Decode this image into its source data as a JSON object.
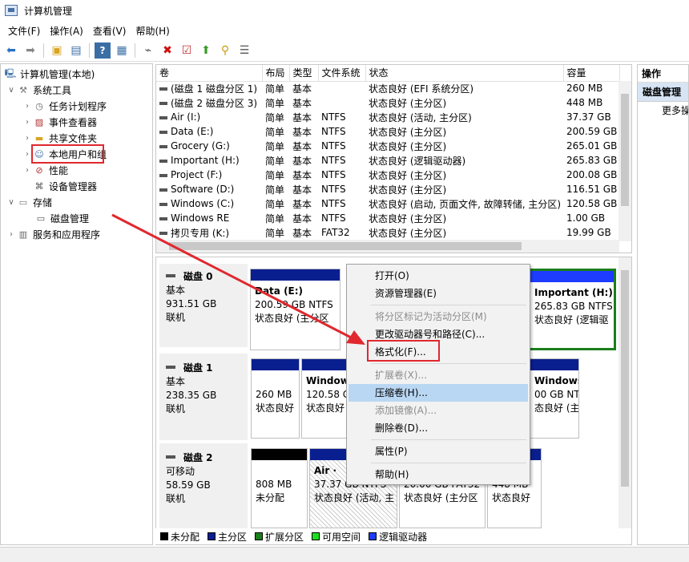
{
  "window": {
    "title": "计算机管理"
  },
  "menu": [
    "文件(F)",
    "操作(A)",
    "查看(V)",
    "帮助(H)"
  ],
  "toolbar": [
    "back-arrow-icon",
    "forward-arrow-icon",
    "up-folder-icon",
    "show-tree-icon",
    "help-icon",
    "properties-icon",
    "connect-icon",
    "delete-icon",
    "check-icon",
    "upload-icon",
    "search-icon",
    "list-icon"
  ],
  "tree": {
    "root": "计算机管理(本地)",
    "system_tools": "系统工具",
    "task_scheduler": "任务计划程序",
    "event_viewer": "事件查看器",
    "shared_folders": "共享文件夹",
    "local_users": "本地用户和组",
    "performance": "性能",
    "device_manager": "设备管理器",
    "storage": "存储",
    "disk_management": "磁盘管理",
    "services_apps": "服务和应用程序"
  },
  "volumes": {
    "headers": [
      "卷",
      "布局",
      "类型",
      "文件系统",
      "状态",
      "容量"
    ],
    "rows": [
      [
        "(磁盘 1 磁盘分区 1)",
        "简单",
        "基本",
        "",
        "状态良好 (EFI 系统分区)",
        "260 MB"
      ],
      [
        "(磁盘 2 磁盘分区 3)",
        "简单",
        "基本",
        "",
        "状态良好 (主分区)",
        "448 MB"
      ],
      [
        "Air      (I:)",
        "简单",
        "基本",
        "NTFS",
        "状态良好 (活动, 主分区)",
        "37.37 GB"
      ],
      [
        "Data (E:)",
        "简单",
        "基本",
        "NTFS",
        "状态良好 (主分区)",
        "200.59 GB"
      ],
      [
        "Grocery (G:)",
        "简单",
        "基本",
        "NTFS",
        "状态良好 (主分区)",
        "265.01 GB"
      ],
      [
        "Important (H:)",
        "简单",
        "基本",
        "NTFS",
        "状态良好 (逻辑驱动器)",
        "265.83 GB"
      ],
      [
        "Project (F:)",
        "简单",
        "基本",
        "NTFS",
        "状态良好 (主分区)",
        "200.08 GB"
      ],
      [
        "Software (D:)",
        "简单",
        "基本",
        "NTFS",
        "状态良好 (主分区)",
        "116.51 GB"
      ],
      [
        "Windows (C:)",
        "简单",
        "基本",
        "NTFS",
        "状态良好 (启动, 页面文件, 故障转储, 主分区)",
        "120.58 GB"
      ],
      [
        "Windows RE",
        "简单",
        "基本",
        "NTFS",
        "状态良好 (主分区)",
        "1.00 GB"
      ],
      [
        "拷贝专用 (K:)",
        "简单",
        "基本",
        "FAT32",
        "状态良好 (主分区)",
        "19.99 GB"
      ]
    ]
  },
  "disks": {
    "disk0": {
      "name": "磁盘 0",
      "type": "基本",
      "size": "931.51 GB",
      "status": "联机",
      "p1": {
        "l1": "Data  (E:)",
        "l2": "200.59 GB NTFS",
        "l3": "状态良好 (主分区"
      },
      "p2": {
        "l1": "Important  (H:)",
        "l2": "265.83 GB NTFS",
        "l3": "状态良好 (逻辑驱"
      }
    },
    "disk1": {
      "name": "磁盘 1",
      "type": "基本",
      "size": "238.35 GB",
      "status": "联机",
      "p1": {
        "l1": "",
        "l2": "260 MB",
        "l3": "状态良好"
      },
      "p2": {
        "l1": "Window",
        "l2": "120.58 G",
        "l3": "状态良好"
      },
      "p3": {
        "l1": "Windows R",
        "l2": "00 GB NTFS",
        "l3": "态良好 (主"
      }
    },
    "disk2": {
      "name": "磁盘 2",
      "type": "可移动",
      "size": "58.59 GB",
      "status": "联机",
      "p1": {
        "l1": "",
        "l2": "808 MB",
        "l3": "未分配"
      },
      "p2": {
        "l1": "Air  ·",
        "l2": "37.37 GB NTFS",
        "l3": "状态良好 (活动, 主"
      },
      "p3": {
        "l1": "",
        "l2": "20.00 GB FAT32",
        "l3": "状态良好 (主分区"
      },
      "p4": {
        "l1": "",
        "l2": "448 MB",
        "l3": "状态良好"
      }
    }
  },
  "legend": [
    {
      "label": "未分配",
      "color": "#000000"
    },
    {
      "label": "主分区",
      "color": "#0a1f8f"
    },
    {
      "label": "扩展分区",
      "color": "#1a7f1a"
    },
    {
      "label": "可用空间",
      "color": "#22dd22"
    },
    {
      "label": "逻辑驱动器",
      "color": "#1e3cff"
    }
  ],
  "actions": {
    "header": "操作",
    "section": "磁盘管理",
    "more": "更多操"
  },
  "context_menu": {
    "open": "打开(O)",
    "explorer": "资源管理器(E)",
    "mark_active": "将分区标记为活动分区(M)",
    "change_letter": "更改驱动器号和路径(C)...",
    "format": "格式化(F)...",
    "extend": "扩展卷(X)...",
    "shrink": "压缩卷(H)...",
    "mirror": "添加镜像(A)...",
    "delete": "删除卷(D)...",
    "properties": "属性(P)",
    "help": "帮助(H)"
  }
}
